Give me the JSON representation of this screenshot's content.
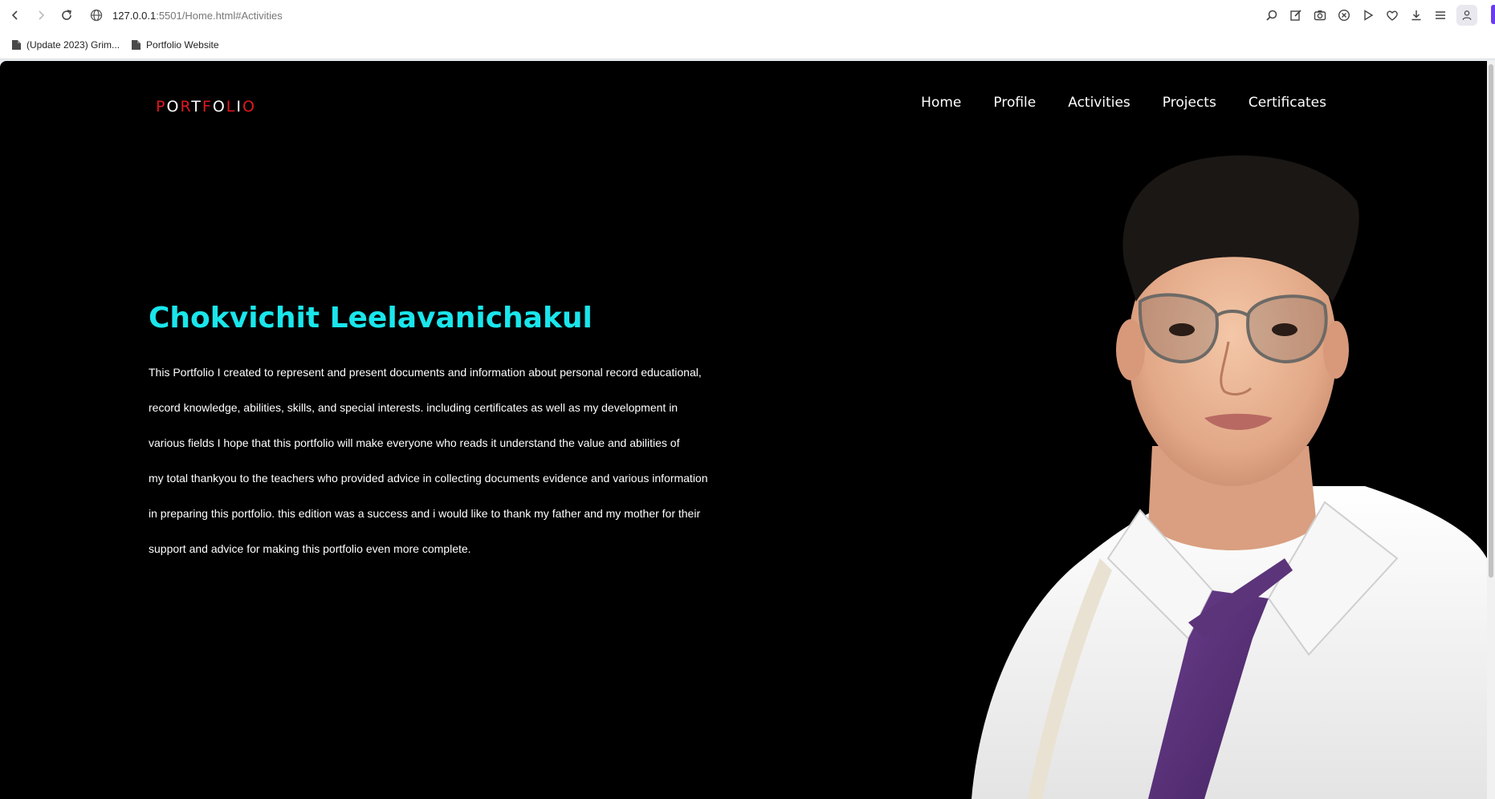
{
  "browser": {
    "url_host": "127.0.0.1",
    "url_path": ":5501/Home.html#Activities",
    "bookmarks": [
      {
        "label": "(Update 2023) Grim..."
      },
      {
        "label": "Portfolio Website"
      }
    ]
  },
  "site": {
    "logo_letters": [
      "P",
      "O",
      "R",
      "T",
      "F",
      "O",
      "L",
      "I",
      "O"
    ],
    "nav": [
      "Home",
      "Profile",
      "Activities",
      "Projects",
      "Certificates"
    ],
    "hero": {
      "name": "Chokvichit Leelavanichakul",
      "lines": [
        "This Portfolio I created to represent and present documents and information about personal record educational,",
        "record knowledge, abilities, skills, and special interests. including certificates as well as my development in",
        "various fields I hope that this portfolio will make everyone who reads it understand the value and abilities of",
        "my total thankyou to the teachers who provided advice in collecting documents evidence and various information",
        "in preparing this portfolio. this edition was a success and i would like to thank my father and my mother for their",
        "support and advice for making this portfolio even more complete."
      ]
    }
  },
  "colors": {
    "accent_name": "#19e6ec",
    "logo_red": "#e0191e",
    "page_bg": "#000000"
  }
}
